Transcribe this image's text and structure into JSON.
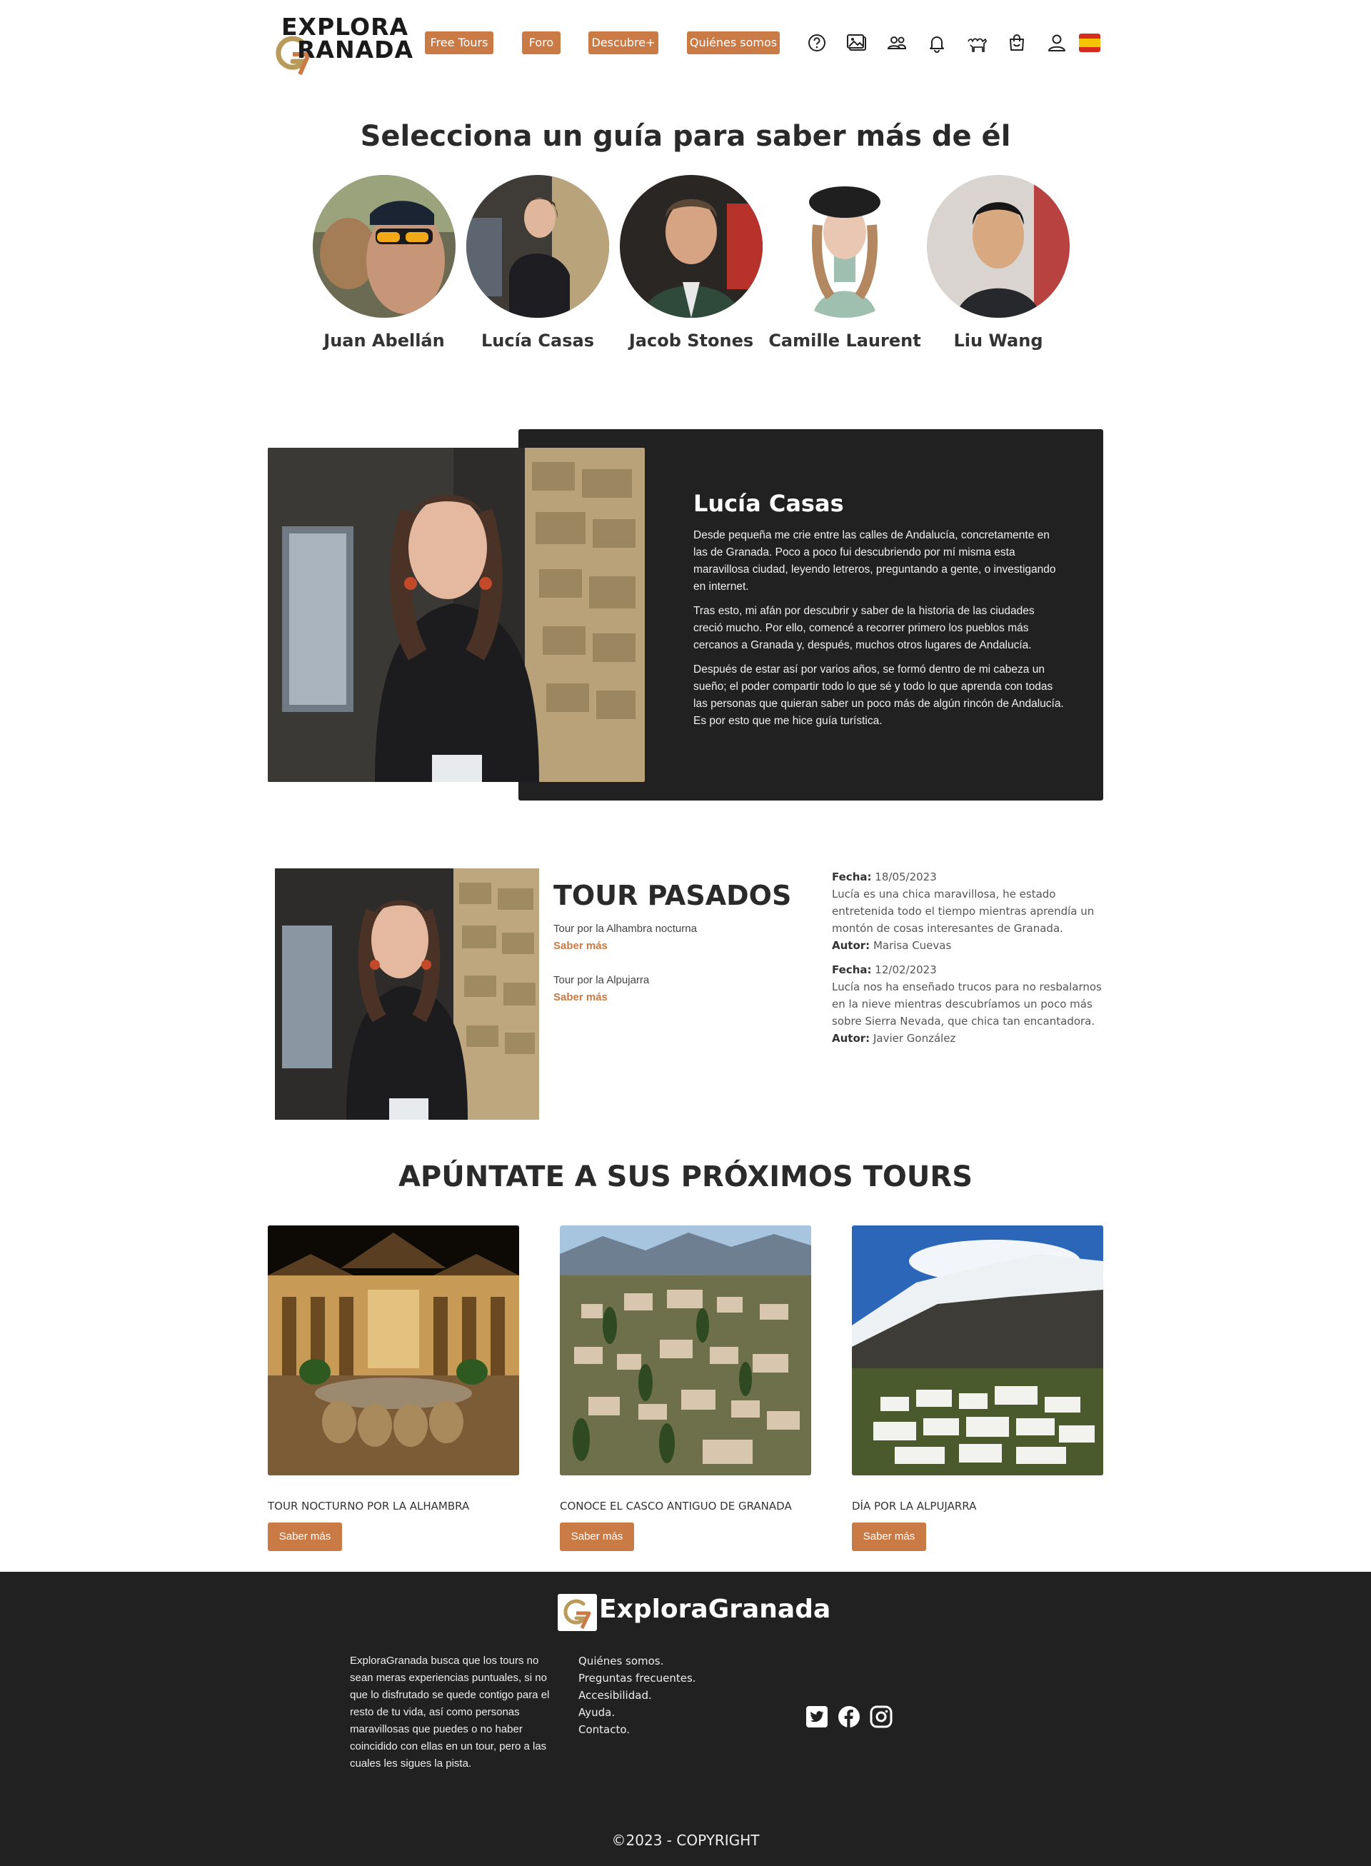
{
  "header": {
    "logo_line1": "EXPLORA",
    "logo_line2": "RANADA",
    "nav": {
      "free_tours": "Free Tours",
      "foro": "Foro",
      "descubre": "Descubre+",
      "quienes": "Quiénes somos"
    },
    "icons": [
      "help-icon",
      "gallery-icon",
      "users-icon",
      "bell-icon",
      "camel-icon",
      "shopping-bag-icon",
      "user-icon",
      "spain-flag-icon"
    ],
    "accent": "#c97a45"
  },
  "guides": {
    "title": "Selecciona un guía para saber más de él",
    "items": [
      {
        "name": "Juan Abellán"
      },
      {
        "name": "Lucía Casas"
      },
      {
        "name": "Jacob Stones"
      },
      {
        "name": "Camille Laurent"
      },
      {
        "name": "Liu Wang"
      }
    ]
  },
  "profile": {
    "name": "Lucía Casas",
    "bio": [
      "Desde pequeña me crie entre las calles de Andalucía, concretamente en las de Granada. Poco a poco fui descubriendo por mí misma esta maravillosa ciudad, leyendo letreros, preguntando a gente, o investigando en internet.",
      "Tras esto, mi afán por descubrir y saber de la historia de las ciudades creció mucho. Por ello, comencé a recorrer primero los pueblos más cercanos a Granada y, después, muchos otros lugares de Andalucía.",
      "Después de estar así por varios años, se formó dentro de mi cabeza un sueño; el poder compartir todo lo que sé y todo lo que aprenda con todas las personas que quieran saber un poco más de algún rincón de Andalucía. Es por esto que me hice guía turística."
    ]
  },
  "past": {
    "title": "TOUR PASADOS",
    "tours": [
      {
        "name": "Tour por la Alhambra nocturna",
        "more": "Saber más"
      },
      {
        "name": "Tour por la Alpujarra",
        "more": "Saber más"
      }
    ],
    "reviews": [
      {
        "date_label": "Fecha:",
        "date": "18/05/2023",
        "text": "Lucía es una chica maravillosa, he estado entretenida todo el tiempo mientras aprendía un montón de cosas interesantes de Granada.",
        "author_label": "Autor:",
        "author": "Marisa Cuevas"
      },
      {
        "date_label": "Fecha:",
        "date": "12/02/2023",
        "text": "Lucía nos ha enseñado trucos para no resbalarnos en la nieve mientras descubríamos un poco más sobre Sierra Nevada, que chica tan encantadora.",
        "author_label": "Autor:",
        "author": "Javier González"
      }
    ]
  },
  "upcoming": {
    "title": "APÚNTATE A SUS PRÓXIMOS TOURS",
    "tours": [
      {
        "name": "TOUR NOCTURNO POR LA ALHAMBRA",
        "button": "Saber más"
      },
      {
        "name": "CONOCE EL CASCO ANTIGUO DE GRANADA",
        "button": "Saber más"
      },
      {
        "name": "DÍA POR LA ALPUJARRA",
        "button": "Saber más"
      }
    ]
  },
  "footer": {
    "brand": "ExploraGranada",
    "about": "ExploraGranada busca que los tours no sean meras experiencias puntuales, si no que lo disfrutado se quede contigo para el resto de tu vida, así como personas maravillosas que puedes o no haber coincidido con ellas en un tour, pero a las cuales les sigues la pista.",
    "links": [
      "Quiénes somos.",
      "Preguntas frecuentes.",
      "Accesibilidad.",
      "Ayuda.",
      "Contacto."
    ],
    "social": [
      "twitter-icon",
      "facebook-icon",
      "instagram-icon"
    ],
    "copyright": "©2023 - COPYRIGHT"
  }
}
